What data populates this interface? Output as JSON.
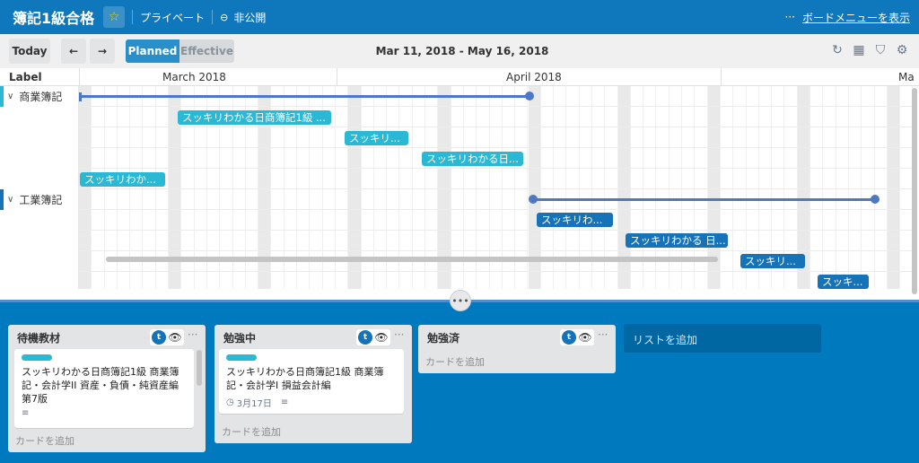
{
  "header": {
    "board_title": "簿記1級合格",
    "visibility": "プライベート",
    "team": "非公開",
    "menu_dots": "···",
    "menu_link": "ボードメニューを表示"
  },
  "toolbar": {
    "today": "Today",
    "prev": "←",
    "next": "→",
    "planned": "Planned",
    "effective": "Effective",
    "date_range": "Mar 11, 2018 - May 16, 2018"
  },
  "timeline": {
    "label_header": "Label",
    "months": [
      "March 2018",
      "April 2018",
      "Ma"
    ]
  },
  "groups": [
    {
      "name": "商業簿記",
      "color": "#2ab8d4",
      "tasks": [
        "スッキリわかる日商簿記1級 ...",
        "スッキリ...",
        "スッキリわかる日...",
        "スッキリわか..."
      ]
    },
    {
      "name": "工業簿記",
      "color": "#1773b8",
      "tasks": [
        "スッキリわ...",
        "スッキリわかる 日...",
        "スッキリ...",
        "スッキ..."
      ]
    }
  ],
  "lists": [
    {
      "title": "待機教材",
      "card": {
        "text_lines": [
          "スッキリわかる日商簿記1級 商業簿",
          "記・会計学II 資産・負債・純資産編",
          "第7版"
        ]
      },
      "add_card": "カードを追加"
    },
    {
      "title": "勉強中",
      "card": {
        "text_lines": [
          "スッキリわかる日商簿記1級 商業簿",
          "記・会計学I 損益会計編"
        ],
        "due": "3月17日"
      },
      "add_card": "カードを追加"
    },
    {
      "title": "勉強済",
      "add_card": "カードを追加"
    }
  ],
  "add_list": "リストを追加",
  "icons": {
    "trello_badge": "t",
    "eye": "👁",
    "more": "···",
    "divider_handle": "•••"
  }
}
